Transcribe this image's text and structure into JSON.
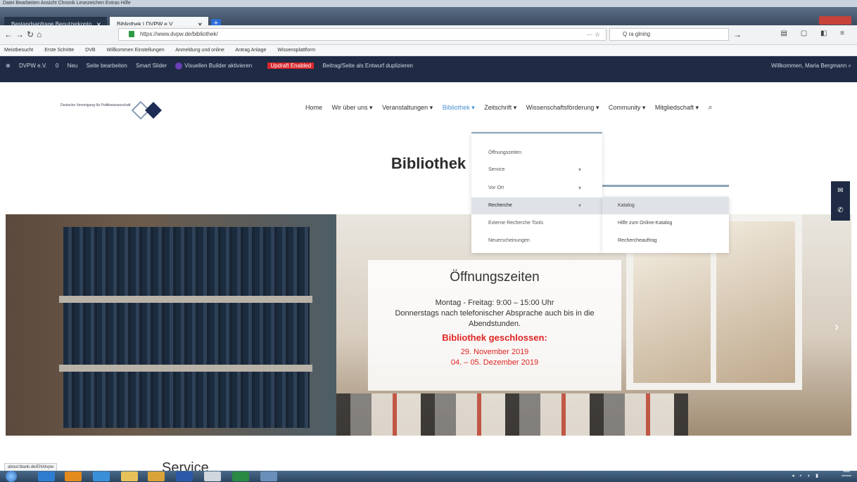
{
  "browser": {
    "menu": "Datei  Bearbeiten  Ansicht  Chronik  Lesezeichen  Extras  Hilfe",
    "tabs": [
      {
        "label": "Bestandsanfrage Benutzerkonto"
      },
      {
        "label": "Bibliothek | DVPW e.V."
      }
    ],
    "url": "https://www.dvpw.de/bibliothek/",
    "search_value": "Q ra glning",
    "bookmarks": [
      "Meistbesucht",
      "Erste Schritte",
      "DVB",
      "Willkommen Einstellungen",
      "Anmeldung und online",
      "Antrag Anlage",
      "Wissensplattform"
    ]
  },
  "adminbar": {
    "items": [
      "DVPW e.V.",
      "0",
      "Neu",
      "Seite bearbeiten",
      "Smart Slider",
      "Visuellen Builder aktivieren"
    ],
    "red_badge": "Updraft Enabled",
    "last_item": "Beitrag/Seite als Entwurf duplizieren",
    "greeting": "Willkommen, Maria Bergmann"
  },
  "header": {
    "logo_text": "Deutsche Vereinigung für Politikwissenschaft",
    "nav": [
      "Home",
      "Wir über uns ▾",
      "Veranstaltungen ▾",
      "Bibliothek ▾",
      "Zeitschrift ▾",
      "Wissenschaftsförderung ▾",
      "Community ▾",
      "Mitgliedschaft ▾"
    ]
  },
  "dropdown": {
    "items": [
      {
        "label": "Öffnungszeiten",
        "caret": ""
      },
      {
        "label": "Service",
        "caret": "▾"
      },
      {
        "label": "Vor Ort",
        "caret": "▾"
      },
      {
        "label": "Recherche",
        "caret": "▾"
      },
      {
        "label": "Externe Recherche Tools",
        "caret": ""
      },
      {
        "label": "Neuerscheinungen",
        "caret": ""
      }
    ],
    "submenu": [
      "Katalog",
      "Hilfe zum Online-Katalog",
      "Rechercheauftrag"
    ]
  },
  "page": {
    "title": "Bibliothek",
    "hours_title": "Öffnungszeiten",
    "hours_line1": "Montag - Freitag: 9:00 – 15:00 Uhr",
    "hours_line2": "Donnerstags nach telefonischer Absprache auch bis in die",
    "hours_line3": "Abendstunden.",
    "closed_title": "Bibliothek geschlossen:",
    "closed_date1": "29. November 2019",
    "closed_date2": "04. – 05. Dezember 2019",
    "next_section": "Service",
    "status_url": "about:blank.de/EN/dvpw"
  },
  "colors": {
    "adminbar": "#1f2b44",
    "accent": "#4a8fd1",
    "closed": "#e02424"
  }
}
